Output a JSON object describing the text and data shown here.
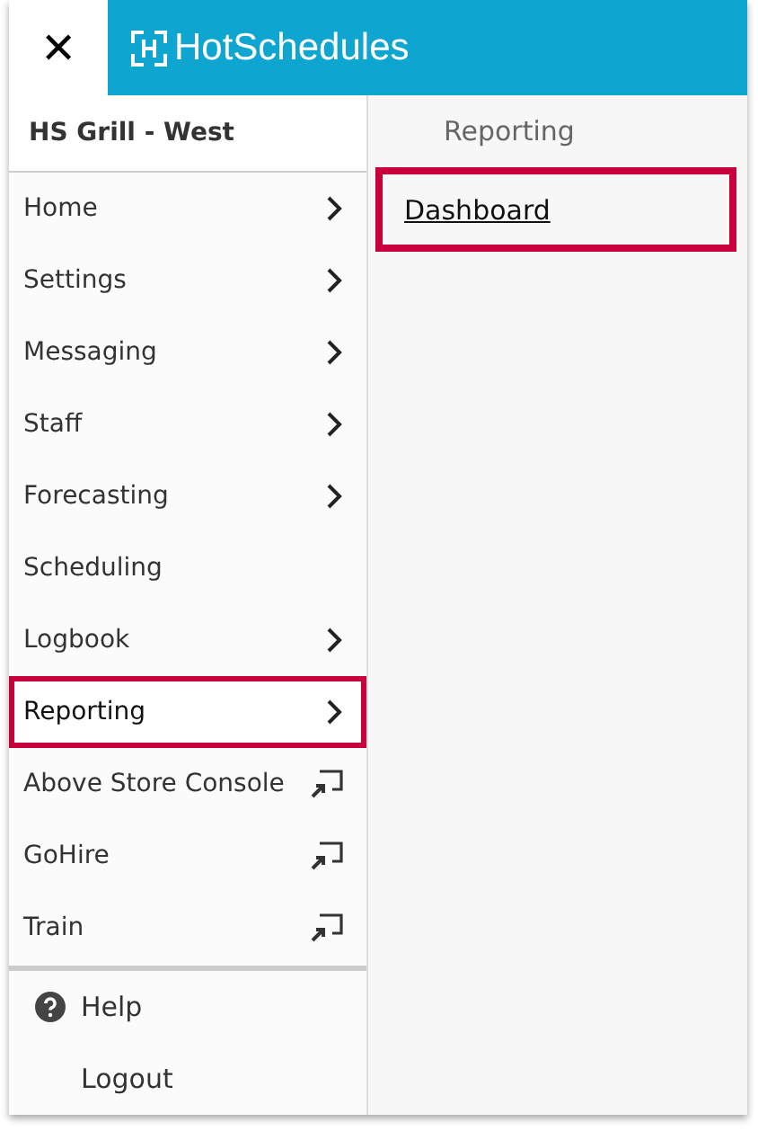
{
  "header": {
    "close_label": "✕",
    "logo_text": "HotSchedules"
  },
  "location": "HS Grill - West",
  "menu": [
    {
      "label": "Home",
      "kind": "submenu",
      "highlighted": false
    },
    {
      "label": "Settings",
      "kind": "submenu",
      "highlighted": false
    },
    {
      "label": "Messaging",
      "kind": "submenu",
      "highlighted": false
    },
    {
      "label": "Staff",
      "kind": "submenu",
      "highlighted": false
    },
    {
      "label": "Forecasting",
      "kind": "submenu",
      "highlighted": false
    },
    {
      "label": "Scheduling",
      "kind": "plain",
      "highlighted": false
    },
    {
      "label": "Logbook",
      "kind": "submenu",
      "highlighted": false
    },
    {
      "label": "Reporting",
      "kind": "submenu",
      "highlighted": true
    },
    {
      "label": "Above Store Console",
      "kind": "external",
      "highlighted": false
    },
    {
      "label": "GoHire",
      "kind": "external",
      "highlighted": false
    },
    {
      "label": "Train",
      "kind": "external",
      "highlighted": false
    }
  ],
  "footer": [
    {
      "label": "Help",
      "kind": "help"
    },
    {
      "label": "Logout",
      "kind": "plain"
    }
  ],
  "submenu": {
    "title": "Reporting",
    "items": [
      {
        "label": "Dashboard",
        "highlighted": true
      }
    ]
  }
}
